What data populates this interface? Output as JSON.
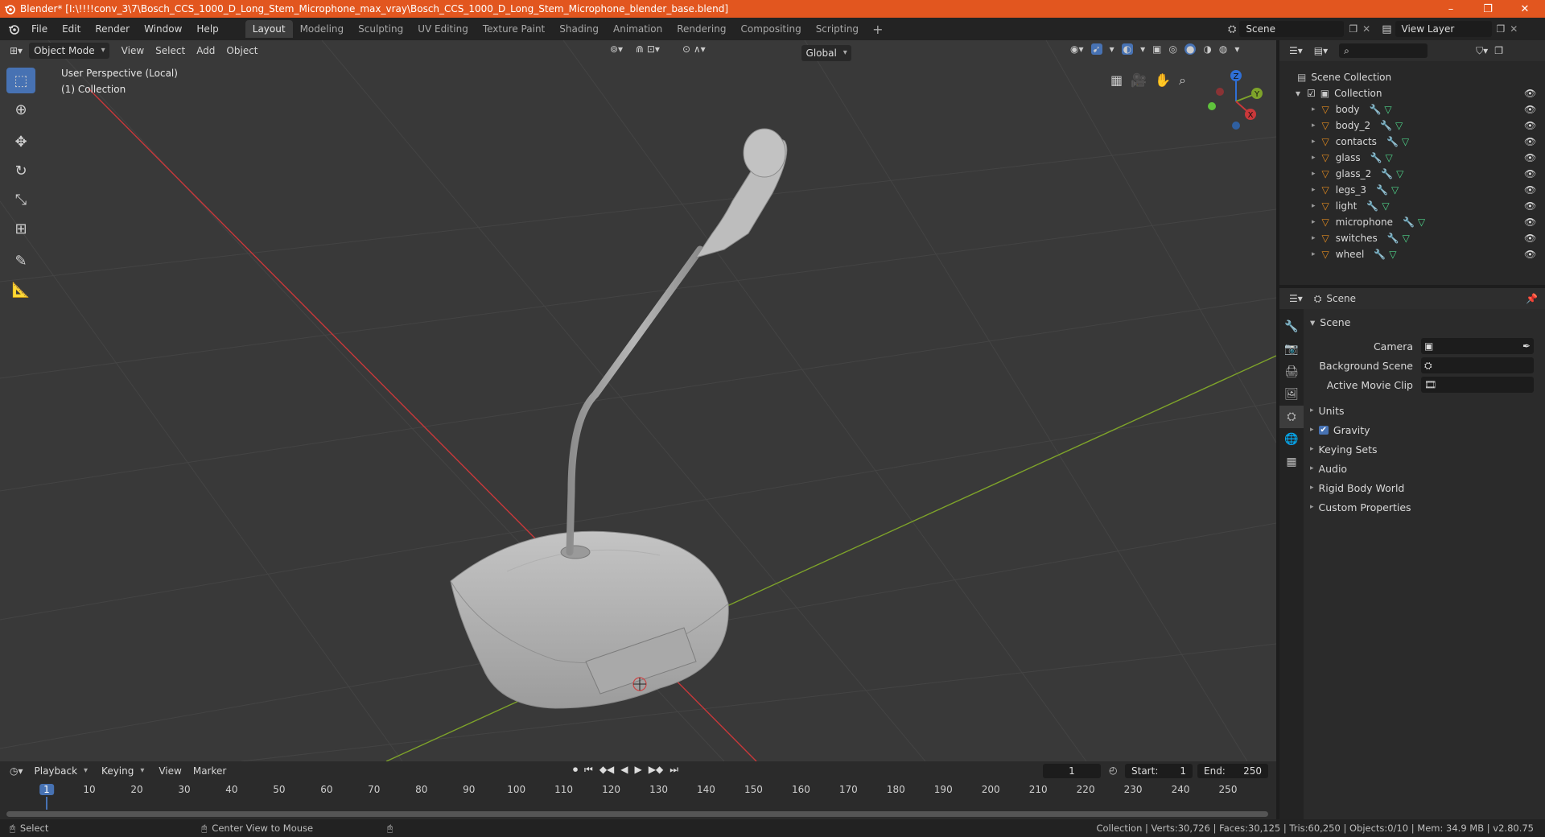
{
  "window": {
    "title": "Blender* [I:\\!!!!conv_3\\7\\Bosch_CCS_1000_D_Long_Stem_Microphone_max_vray\\Bosch_CCS_1000_D_Long_Stem_Microphone_blender_base.blend]",
    "minimize": "–",
    "maximize": "❐",
    "close": "✕"
  },
  "menus": [
    "File",
    "Edit",
    "Render",
    "Window",
    "Help"
  ],
  "workspaces": [
    "Layout",
    "Modeling",
    "Sculpting",
    "UV Editing",
    "Texture Paint",
    "Shading",
    "Animation",
    "Rendering",
    "Compositing",
    "Scripting"
  ],
  "scene_field": "Scene",
  "view_layer_field": "View Layer",
  "viewport": {
    "mode": "Object Mode",
    "menus": [
      "View",
      "Select",
      "Add",
      "Object"
    ],
    "orientation": "Global",
    "perspective_label": "User Perspective (Local)",
    "collection_label": "(1) Collection"
  },
  "gizmo": {
    "x": "X",
    "y": "Y",
    "z": "Z"
  },
  "outliner": {
    "root": "Scene Collection",
    "collection": "Collection",
    "objects": [
      "body",
      "body_2",
      "contacts",
      "glass",
      "glass_2",
      "legs_3",
      "light",
      "microphone",
      "switches",
      "wheel"
    ]
  },
  "properties": {
    "header": "Scene",
    "panel_title": "Scene",
    "fields": [
      {
        "label": "Camera"
      },
      {
        "label": "Background Scene"
      },
      {
        "label": "Active Movie Clip"
      }
    ],
    "sections": [
      "Units",
      "Gravity",
      "Keying Sets",
      "Audio",
      "Rigid Body World",
      "Custom Properties"
    ]
  },
  "timeline": {
    "menus": [
      "Playback",
      "Keying",
      "View",
      "Marker"
    ],
    "current_frame": "1",
    "start_label": "Start:",
    "start": "1",
    "end_label": "End:",
    "end": "250",
    "ticks": [
      "1",
      "10",
      "20",
      "30",
      "40",
      "50",
      "60",
      "70",
      "80",
      "90",
      "100",
      "110",
      "120",
      "130",
      "140",
      "150",
      "160",
      "170",
      "180",
      "190",
      "200",
      "210",
      "220",
      "230",
      "240",
      "250"
    ]
  },
  "status": {
    "left": "Select",
    "middle": "Center View to Mouse",
    "right": "Collection | Verts:30,726 | Faces:30,125 | Tris:60,250 | Objects:0/10 | Mem: 34.9 MB | v2.80.75"
  },
  "colors": {
    "accent": "#4772b3",
    "titlebar": "#e2561f",
    "object_orange": "#e0891f",
    "mesh_green": "#4fd48a",
    "axis_red": "#c9383a",
    "axis_green": "#7ea32a"
  }
}
